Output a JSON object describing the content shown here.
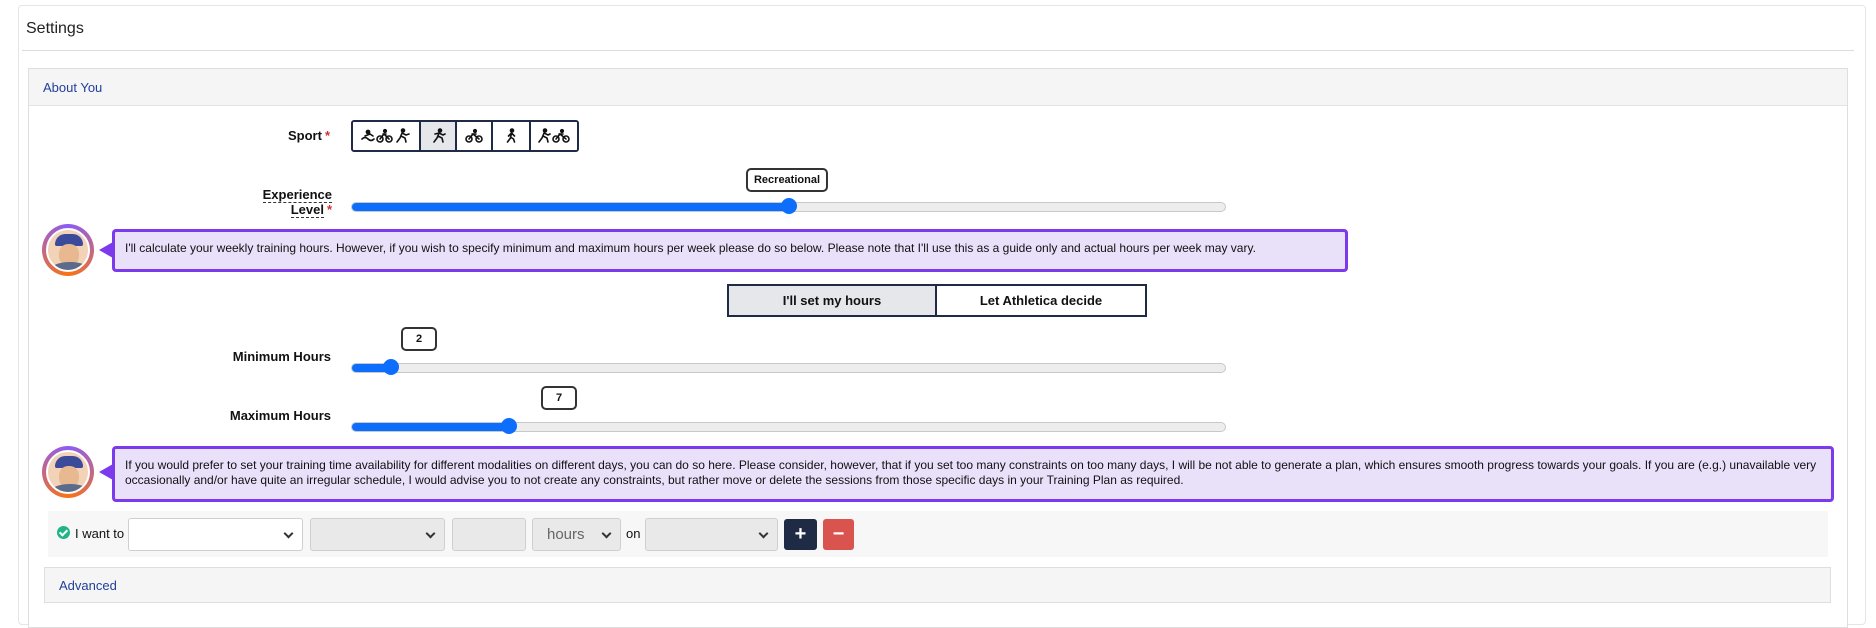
{
  "page": {
    "title": "Settings"
  },
  "about": {
    "header": "About You",
    "sport": {
      "label": "Sport",
      "required": "*",
      "options": [
        {
          "icon": "triathlon-icon",
          "active": false
        },
        {
          "icon": "running-icon",
          "active": true
        },
        {
          "icon": "cycling-icon",
          "active": false
        },
        {
          "icon": "walking-icon",
          "active": false
        },
        {
          "icon": "duathlon-icon",
          "active": false
        }
      ]
    },
    "experience": {
      "label": "Experience Level",
      "required": "*",
      "value_label": "Recreational",
      "level_fraction": 0.5
    },
    "coach_note_1": "I'll calculate your weekly training hours. However, if you wish to specify minimum and maximum hours per week please do so below. Please note that I'll use this as a guide only and actual hours per week may vary.",
    "hours_mode": {
      "options": [
        "I'll set my hours",
        "Let Athletica decide"
      ],
      "selected": "I'll set my hours"
    },
    "min_hours": {
      "label": "Minimum Hours",
      "value": "2",
      "fraction": 0.045
    },
    "max_hours": {
      "label": "Maximum Hours",
      "value": "7",
      "fraction": 0.18
    },
    "coach_note_2": "If you would prefer to set your training time availability for different modalities on different days, you can do so here. Please consider, however, that if you set too many constraints on too many days, I will be not able to generate a plan, which ensures smooth progress towards your goals. If you are (e.g.) unavailable very occasionally and/or have quite an irregular schedule, I would advise you to not create any constraints, but rather move or delete the sessions from those specific days in your Training Plan as required.",
    "constraint": {
      "prefix": "I want to",
      "action_value": "",
      "modality_value": "",
      "amount_value": "",
      "unit_value": "hours",
      "on_label": "on",
      "day_value": "",
      "add_label": "+",
      "remove_label": "−"
    },
    "advanced": "Advanced"
  },
  "colors": {
    "accent": "#0d6efd",
    "coach_border": "#7c3aed",
    "coach_bg": "#e9e0fa",
    "nav_dark": "#1f2a44",
    "danger": "#d9534f",
    "link": "#22409a"
  }
}
